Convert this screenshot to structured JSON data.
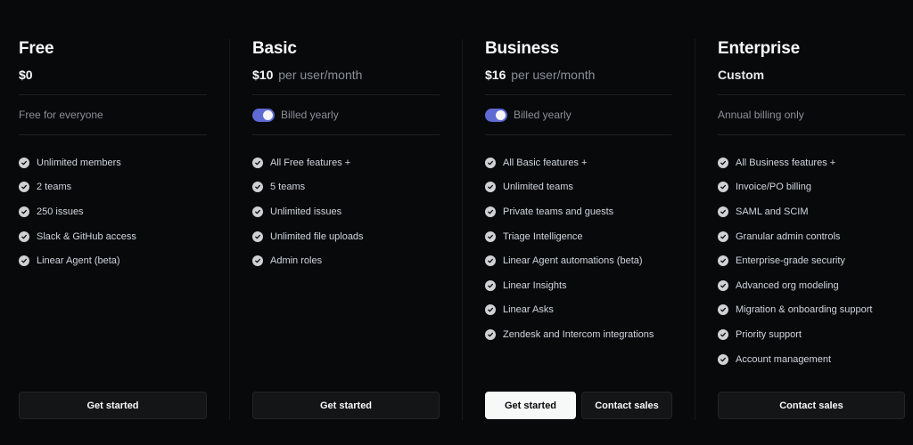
{
  "plans": [
    {
      "name": "Free",
      "price": "$0",
      "per": "",
      "billing": "Free for everyone",
      "toggle": false,
      "features": [
        "Unlimited members",
        "2 teams",
        "250 issues",
        "Slack & GitHub access",
        "Linear Agent (beta)"
      ],
      "buttons": [
        {
          "label": "Get started",
          "primary": false
        }
      ]
    },
    {
      "name": "Basic",
      "price": "$10",
      "per": "per user/month",
      "billing": "Billed yearly",
      "toggle": true,
      "features": [
        "All Free features +",
        "5 teams",
        "Unlimited issues",
        "Unlimited file uploads",
        "Admin roles"
      ],
      "buttons": [
        {
          "label": "Get started",
          "primary": false
        }
      ]
    },
    {
      "name": "Business",
      "price": "$16",
      "per": "per user/month",
      "billing": "Billed yearly",
      "toggle": true,
      "features": [
        "All Basic features +",
        "Unlimited teams",
        "Private teams and guests",
        "Triage Intelligence",
        "Linear Agent automations (beta)",
        "Linear Insights",
        "Linear Asks",
        "Zendesk and Intercom integrations"
      ],
      "buttons": [
        {
          "label": "Get started",
          "primary": true
        },
        {
          "label": "Contact sales",
          "primary": false
        }
      ]
    },
    {
      "name": "Enterprise",
      "price": "Custom",
      "per": "",
      "billing": "Annual billing only",
      "toggle": false,
      "features": [
        "All Business features +",
        "Invoice/PO billing",
        "SAML and SCIM",
        "Granular admin controls",
        "Enterprise-grade security",
        "Advanced org modeling",
        "Migration & onboarding support",
        "Priority support",
        "Account management"
      ],
      "buttons": [
        {
          "label": "Contact sales",
          "primary": false
        }
      ]
    }
  ],
  "colors": {
    "background": "#08090a",
    "toggle_on": "#5e6ad2",
    "primary_button": "#f7f8f8"
  },
  "icons": {
    "feature": "check-circle-icon"
  }
}
